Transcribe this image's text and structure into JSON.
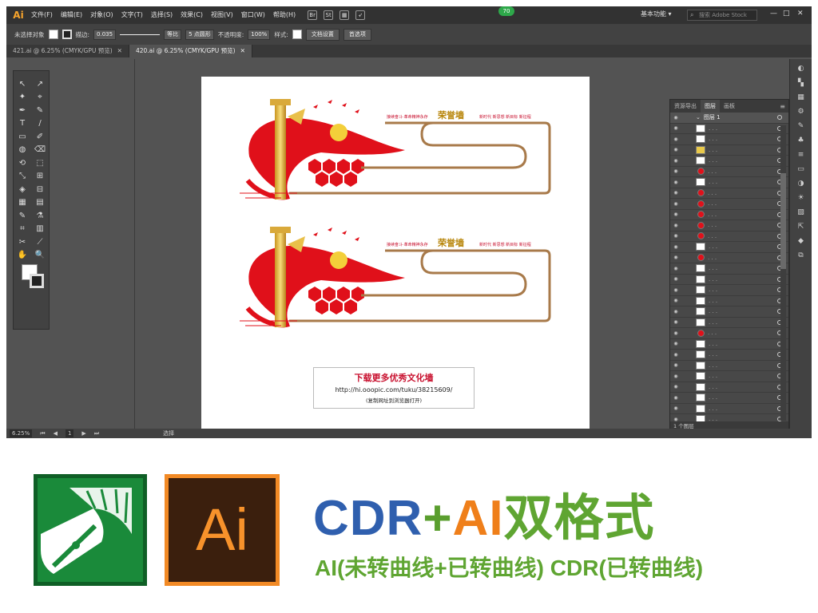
{
  "app": {
    "logo": "Ai",
    "menu": [
      "文件(F)",
      "编辑(E)",
      "对象(O)",
      "文字(T)",
      "选择(S)",
      "效果(C)",
      "视图(V)",
      "窗口(W)",
      "帮助(H)"
    ],
    "menu_icons": [
      "bridge-icon",
      "stock-icon",
      "arrange-icon",
      "rocket-icon"
    ],
    "badge": "70",
    "workspace": "基本功能",
    "search_placeholder": "搜索 Adobe Stock",
    "window_controls": [
      "—",
      "□",
      "✕"
    ]
  },
  "control_bar": {
    "selection": "未选择对象",
    "stroke_label": "描边:",
    "stroke_value": "0.035",
    "profile": "等比",
    "brush": "5 点圆形",
    "opacity_label": "不透明度:",
    "opacity_value": "100%",
    "style_label": "样式:",
    "doc_setup": "文档设置",
    "preferences": "首选项"
  },
  "tabs": [
    {
      "label": "421.ai @ 6.25% (CMYK/GPU 预览)",
      "active": false
    },
    {
      "label": "420.ai @ 6.25% (CMYK/GPU 预览)",
      "active": true
    }
  ],
  "tools": [
    [
      "↖",
      "↗"
    ],
    [
      "✦",
      "⌖"
    ],
    [
      "✒",
      "✎"
    ],
    [
      "T",
      "/"
    ],
    [
      "▭",
      "✐"
    ],
    [
      "◍",
      "⌫"
    ],
    [
      "⟲",
      "⬚"
    ],
    [
      "⤡",
      "⊞"
    ],
    [
      "◈",
      "⊟"
    ],
    [
      "▦",
      "▤"
    ],
    [
      "✎",
      "⚗"
    ],
    [
      "⌗",
      "▥"
    ],
    [
      "✂",
      "⟋"
    ],
    [
      "✋",
      "🔍"
    ]
  ],
  "artwork": {
    "slogan_left": "接续奋斗·革命精神永存",
    "title": "荣誉墙",
    "slogan_right": "新时代 新思想 新目标 新征程"
  },
  "download": {
    "title": "下载更多优秀文化墙",
    "url": "http://hi.ooopic.com/tuku/38215609/",
    "note": "(复制网址到浏览器打开)"
  },
  "layers_panel": {
    "tabs": [
      "资源导出",
      "图层",
      "画板"
    ],
    "active_tab": "图层",
    "layer_name": "图层 1",
    "footer": "1 个图层"
  },
  "status": {
    "zoom": "6.25%",
    "page": "1",
    "tool": "选择"
  },
  "promo": {
    "ai_label": "Ai",
    "headline_cdr": "CDR",
    "headline_plus": "+",
    "headline_ai": "AI",
    "headline_fmt": "双格式",
    "subline": "AI(未转曲线+已转曲线) CDR(已转曲线)"
  },
  "colors": {
    "red": "#e0101a",
    "gold": "#b8860b",
    "brown_frame": "#a87a4a",
    "cdr_green": "#1a8a3a",
    "ai_orange": "#f28a25"
  }
}
